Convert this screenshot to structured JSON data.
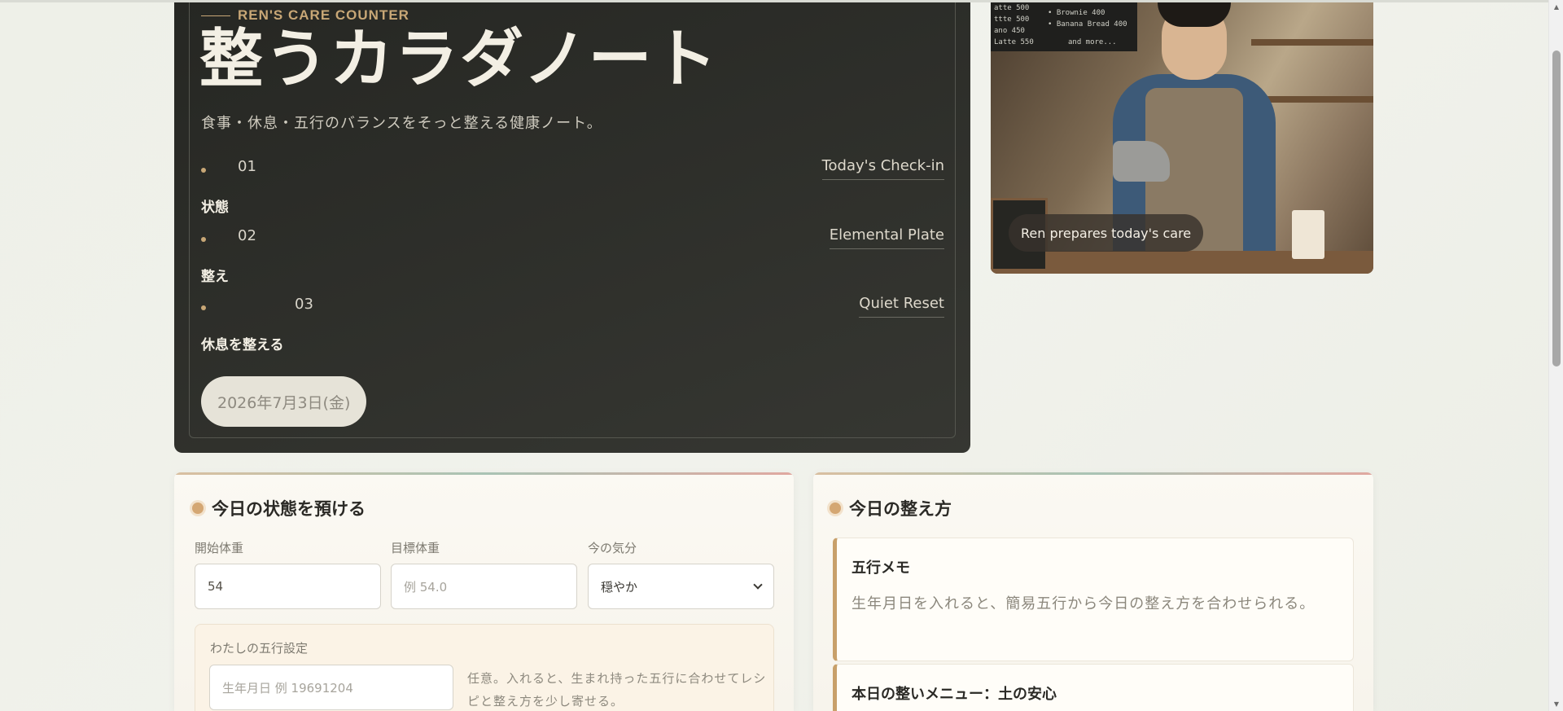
{
  "hero": {
    "eyebrow": "REN'S CARE COUNTER",
    "title": "整うカラダノート",
    "subtitle": "食事・休息・五行のバランスをそっと整える健康ノート。",
    "steps": [
      {
        "num": "01",
        "right": "Today's Check-in",
        "label": "状態"
      },
      {
        "num": "02",
        "right": "Elemental Plate",
        "label": "整え"
      },
      {
        "num": "03",
        "right": "Quiet Reset",
        "label": "休息を整える"
      }
    ],
    "date": "2026年7月3日(金)"
  },
  "photo": {
    "caption": "Ren prepares today's care",
    "menu_board": [
      "atte 500",
      "ttte 500",
      "ano 450",
      "Latte 550",
      "• Brownie 400",
      "• Banana Bread 400",
      "and more..."
    ]
  },
  "checkin": {
    "title": "今日の状態を預ける",
    "start_weight_label": "開始体重",
    "start_weight_value": "54",
    "target_weight_label": "目標体重",
    "target_weight_placeholder": "例 54.0",
    "mood_label": "今の気分",
    "mood_value": "穏やか",
    "gogyo_label": "わたしの五行設定",
    "birthdate_placeholder": "生年月日 例 19691204",
    "gogyo_help": "任意。入れると、生まれ持った五行に合わせてレシピと整え方を少し寄せる。"
  },
  "plan": {
    "title": "今日の整え方",
    "memo_title": "五行メモ",
    "memo_text": "生年月日を入れると、簡易五行から今日の整え方を合わせられる。",
    "menu_title": "本日の整いメニュー：土の安心"
  },
  "colors": {
    "hero_bg": "#2c2d29",
    "accent": "#c8a776",
    "panel_bg": "#fbf9f3"
  }
}
